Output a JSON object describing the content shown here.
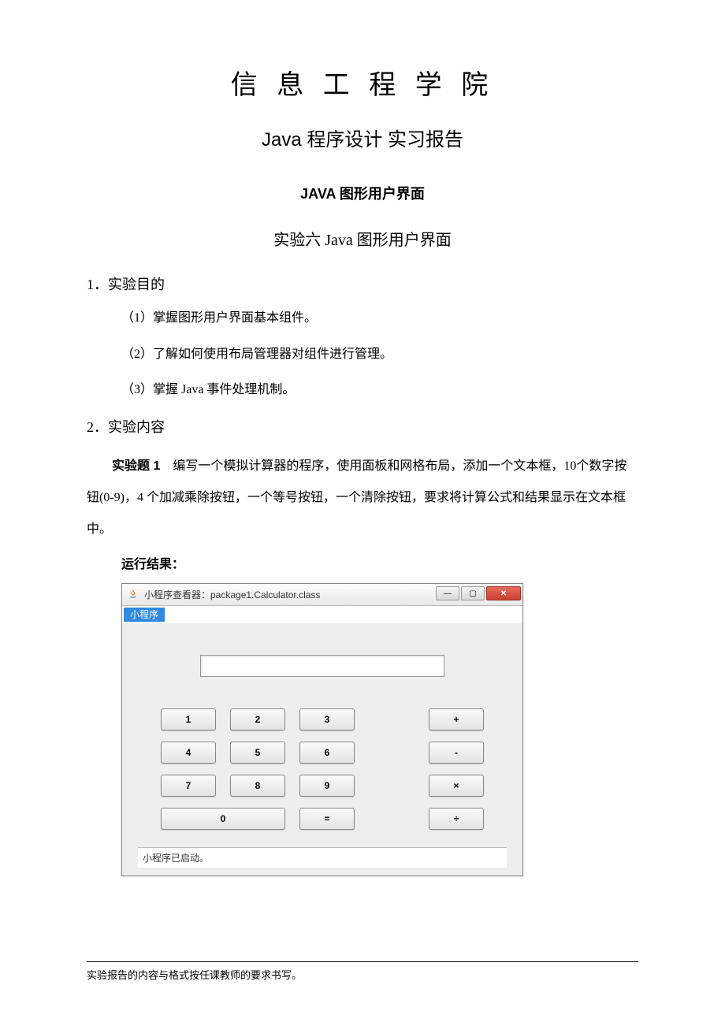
{
  "doc": {
    "inst": "信 息 工 程 学 院",
    "report_title": "Java 程序设计 实习报告",
    "section_title": "JAVA 图形用户界面",
    "experiment_title": "实验六 Java 图形用户界面",
    "h1": "1．实验目的",
    "obj1": "（1）掌握图形用户界面基本组件。",
    "obj2": "（2）了解如何使用布局管理器对组件进行管理。",
    "obj3": "（3）掌握 Java 事件处理机制。",
    "h2": "2．实验内容",
    "task_label": "实验题 1",
    "task_text": "　编写一个模拟计算器的程序，使用面板和网格布局，添加一个文本框，10个数字按钮(0-9)，4 个加减乘除按钮，一个等号按钮，一个清除按钮，要求将计算公式和结果显示在文本框中。",
    "run_label": "运行结果：",
    "footer": "实验报告的内容与格式按任课教师的要求书写。"
  },
  "applet": {
    "window_title": "小程序查看器：package1.Calculator.class",
    "menu": "小程序",
    "display_value": "",
    "status": "小程序已启动。",
    "keys": {
      "k1": "1",
      "k2": "2",
      "k3": "3",
      "kp": "+",
      "k4": "4",
      "k5": "5",
      "k6": "6",
      "km": "-",
      "k7": "7",
      "k8": "8",
      "k9": "9",
      "kx": "×",
      "k0": "0",
      "ke": "=",
      "kd": "÷"
    },
    "win_close_glyph": "✕",
    "win_max_glyph": "▢",
    "win_min_glyph": "—"
  }
}
